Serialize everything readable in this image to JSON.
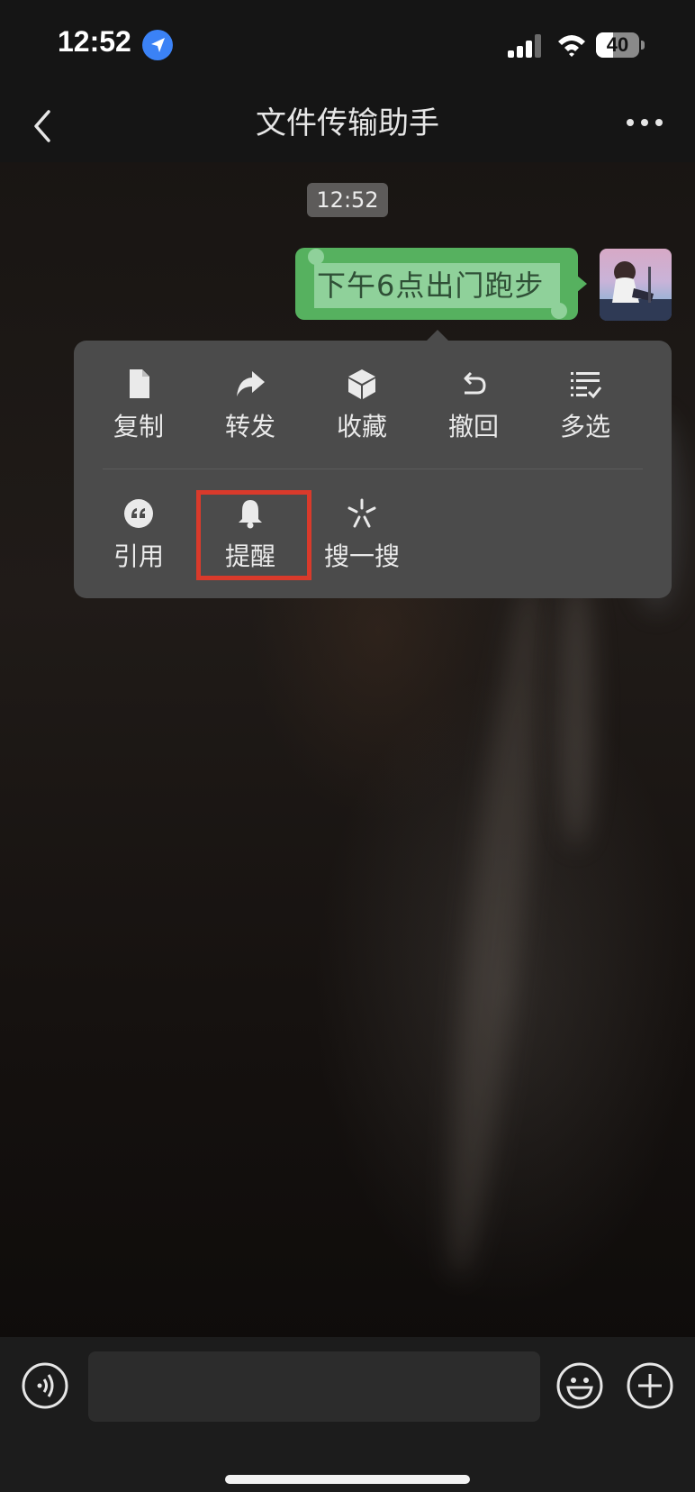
{
  "status_bar": {
    "time": "12:52",
    "battery": "40",
    "battery_fraction": 0.4,
    "icons": [
      "location-icon",
      "signal-icon",
      "wifi-icon",
      "battery-icon"
    ]
  },
  "nav": {
    "title": "文件传输助手",
    "back_icon": "chevron-left-icon",
    "more_icon": "more-dots-icon"
  },
  "chat": {
    "timestamp": "12:52",
    "message": "下午6点出门跑步",
    "bubble_color": "#56b15f",
    "selection_color": "#8fd19a"
  },
  "menu": {
    "row1": [
      {
        "label": "复制",
        "icon": "document-icon"
      },
      {
        "label": "转发",
        "icon": "forward-icon"
      },
      {
        "label": "收藏",
        "icon": "cube-icon"
      },
      {
        "label": "撤回",
        "icon": "undo-icon"
      },
      {
        "label": "多选",
        "icon": "multi-select-icon"
      }
    ],
    "row2": [
      {
        "label": "引用",
        "icon": "quote-icon"
      },
      {
        "label": "提醒",
        "icon": "bell-icon"
      },
      {
        "label": "搜一搜",
        "icon": "search-spark-icon"
      }
    ],
    "highlight_color": "#d93a2b"
  },
  "input_bar": {
    "voice_icon": "voice-icon",
    "emoji_icon": "emoji-icon",
    "plus_icon": "plus-icon",
    "input_value": ""
  }
}
